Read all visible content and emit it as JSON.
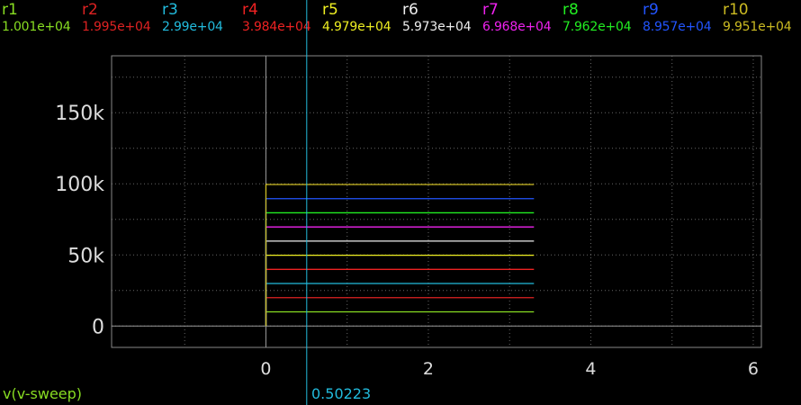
{
  "chart_data": {
    "type": "line",
    "x_variable": "v(v-sweep)",
    "cursor": {
      "x": 0.50223,
      "label": "0.50223",
      "color": "#22bbdd"
    },
    "xlim": [
      -1.9,
      6.1
    ],
    "ylim": [
      -15000,
      190000
    ],
    "x_ticks": [
      {
        "value": 0,
        "label": "0"
      },
      {
        "value": 2,
        "label": "2"
      },
      {
        "value": 4,
        "label": "4"
      },
      {
        "value": 6,
        "label": "6"
      }
    ],
    "y_ticks": [
      {
        "value": 0,
        "label": "0"
      },
      {
        "value": 50000,
        "label": "50k"
      },
      {
        "value": 100000,
        "label": "100k"
      },
      {
        "value": 150000,
        "label": "150k"
      }
    ],
    "x_grid": [
      -1,
      0,
      1,
      2,
      3,
      4,
      5,
      6
    ],
    "y_grid": [
      0,
      25000,
      50000,
      75000,
      100000,
      125000,
      150000,
      175000
    ],
    "sweep": {
      "x_start": 0,
      "x_end": 3.3
    },
    "series": [
      {
        "name": "r1",
        "value": 10010,
        "label": "1.001e+04",
        "color": "#88dd22"
      },
      {
        "name": "r2",
        "value": 19950,
        "label": "1.995e+04",
        "color": "#dd2222"
      },
      {
        "name": "r3",
        "value": 29900,
        "label": "2.99e+04",
        "color": "#22bbdd"
      },
      {
        "name": "r4",
        "value": 39840,
        "label": "3.984e+04",
        "color": "#ee2222"
      },
      {
        "name": "r5",
        "value": 49790,
        "label": "4.979e+04",
        "color": "#eeee22"
      },
      {
        "name": "r6",
        "value": 59730,
        "label": "5.973e+04",
        "color": "#eeeeee"
      },
      {
        "name": "r7",
        "value": 69680,
        "label": "6.968e+04",
        "color": "#ee22ee"
      },
      {
        "name": "r8",
        "value": 79620,
        "label": "7.962e+04",
        "color": "#22ee22"
      },
      {
        "name": "r9",
        "value": 89570,
        "label": "8.957e+04",
        "color": "#2255ff"
      },
      {
        "name": "r10",
        "value": 99510,
        "label": "9.951e+04",
        "color": "#ccbb22"
      }
    ]
  },
  "colors": {
    "background": "#000000",
    "frame": "#888888",
    "grid": "#666666",
    "text": "#dddddd",
    "xvar": "#88dd22"
  }
}
